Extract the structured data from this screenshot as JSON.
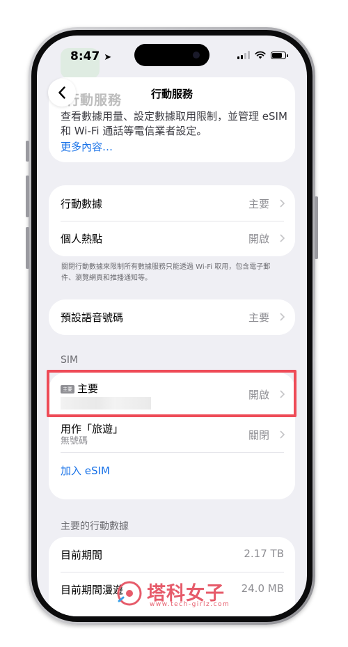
{
  "status_bar": {
    "time": "8:47"
  },
  "nav": {
    "title": "行動服務"
  },
  "top_card": {
    "heading": "行動服務",
    "description": "查看數據用量、設定數據取用限制，並管理 eSIM 和 Wi-Fi 通話等電信業者設定。",
    "more_link": "更多內容…"
  },
  "group1": {
    "rows": [
      {
        "label": "行動數據",
        "value": "主要"
      },
      {
        "label": "個人熱點",
        "value": "開啟"
      }
    ],
    "footnote": "關閉行動數據來限制所有數據服務只能透過 Wi-Fi 取用，包含電子郵件、瀏覽網頁和推播通知等。"
  },
  "group2": {
    "label": "預設語音號碼",
    "value": "主要"
  },
  "sim_section": {
    "header": "SIM",
    "primary": {
      "tag": "主要",
      "label": "主要",
      "value": "開啟"
    },
    "travel": {
      "label": "用作「旅遊」",
      "sublabel": "無號碼",
      "value": "關閉"
    },
    "add_esim": "加入 eSIM"
  },
  "data_section": {
    "header": "主要的行動數據",
    "rows": [
      {
        "label": "目前期間",
        "value": "2.17 TB"
      },
      {
        "label": "目前期間漫遊",
        "value": "24.0 MB"
      }
    ]
  },
  "watermark": {
    "title": "塔科女子",
    "url": "www.tech-girlz.com"
  },
  "colors": {
    "link": "#1a73e8",
    "highlight": "#ee4b57",
    "background": "#efeff4"
  }
}
